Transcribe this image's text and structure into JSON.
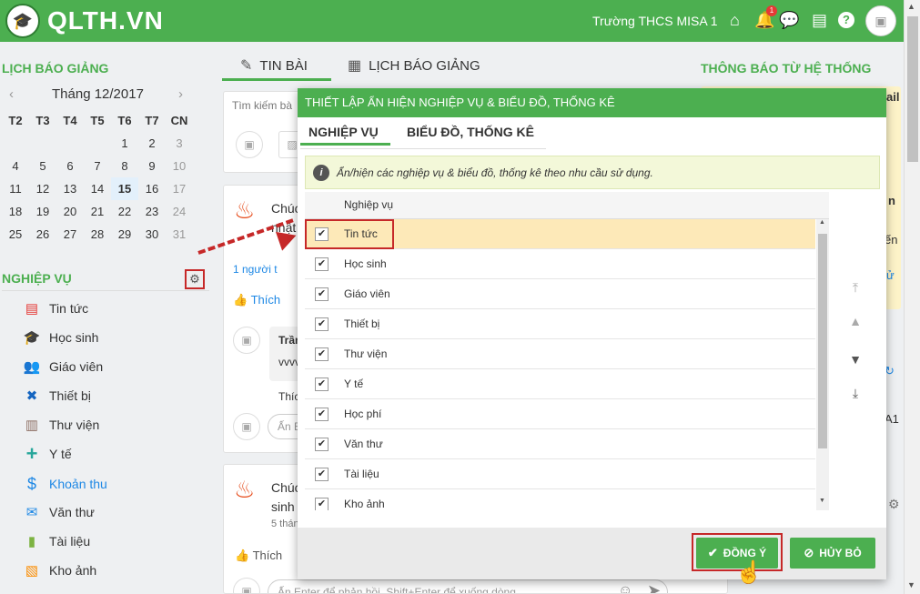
{
  "header": {
    "logo_text": "QLTH.VN",
    "school": "Trường THCS MISA 1",
    "notification_count": "1"
  },
  "calendar": {
    "title": "LỊCH BÁO GIẢNG",
    "month_label": "Tháng 12/2017",
    "prev": "‹",
    "next": "›",
    "weekdays": [
      "T2",
      "T3",
      "T4",
      "T5",
      "T6",
      "T7",
      "CN"
    ],
    "weeks": [
      [
        "",
        "",
        "",
        "",
        "1",
        "2",
        "3"
      ],
      [
        "4",
        "5",
        "6",
        "7",
        "8",
        "9",
        "10"
      ],
      [
        "11",
        "12",
        "13",
        "14",
        "15",
        "16",
        "17"
      ],
      [
        "18",
        "19",
        "20",
        "21",
        "22",
        "23",
        "24"
      ],
      [
        "25",
        "26",
        "27",
        "28",
        "29",
        "30",
        "31"
      ]
    ]
  },
  "sidebar": {
    "title": "NGHIỆP VỤ",
    "items": [
      {
        "label": "Tin tức",
        "icon": "newspaper-icon",
        "color": "#e53935"
      },
      {
        "label": "Học sinh",
        "icon": "graduation-cap-icon",
        "color": "#7b1fa2"
      },
      {
        "label": "Giáo viên",
        "icon": "users-icon",
        "color": "#1e88e5"
      },
      {
        "label": "Thiết bị",
        "icon": "tools-icon",
        "color": "#1565c0"
      },
      {
        "label": "Thư viện",
        "icon": "books-icon",
        "color": "#8d6e63"
      },
      {
        "label": "Y tế",
        "icon": "plus-icon",
        "color": "#26a69a"
      },
      {
        "label": "Khoản thu",
        "icon": "dollar-icon",
        "color": "#1e88e5"
      },
      {
        "label": "Văn thư",
        "icon": "envelope-icon",
        "color": "#1e88e5"
      },
      {
        "label": "Tài liệu",
        "icon": "document-icon",
        "color": "#7cb342"
      },
      {
        "label": "Kho ảnh",
        "icon": "image-icon",
        "color": "#fb8c00"
      }
    ]
  },
  "main_tabs": {
    "news": "TIN BÀI",
    "schedule": "LỊCH BÁO GIẢNG"
  },
  "feed": {
    "search_placeholder": "Tìm kiếm bà",
    "post1_text1": "Chúc",
    "post1_text2": "nhật",
    "post1_likes": "1 người t",
    "like_label": "Thích",
    "comment_name": "Trần",
    "comment_text": "vvvv",
    "comment_like": "Thíc",
    "reply_placeholder1": "Ấn E",
    "post2_text1": "Chúc",
    "post2_text2": "sinh",
    "post2_time": "5 thán",
    "like_label2": "Thích",
    "reply_placeholder2": "Ấn Enter để phản hồi, Shift+Enter để xuống dòng"
  },
  "right_panel": {
    "title": "THÔNG BÁO TỪ HỆ THỐNG",
    "frag1": "ail",
    "frag2": "n",
    "frag3": "ến",
    "frag4": "ử",
    "frag5": "A1"
  },
  "modal": {
    "title": "THIẾT LẬP ẨN HIỆN NGHIỆP VỤ & BIỂU ĐỒ, THỐNG KÊ",
    "tab1": "NGHIỆP VỤ",
    "tab2": "BIỂU ĐỒ, THỐNG KÊ",
    "info": "Ẩn/hiện các nghiệp vụ & biểu đồ, thống kê theo nhu cầu sử dụng.",
    "column_header": "Nghiệp vụ",
    "rows": [
      {
        "label": "Tin tức",
        "checked": true
      },
      {
        "label": "Học sinh",
        "checked": true
      },
      {
        "label": "Giáo viên",
        "checked": true
      },
      {
        "label": "Thiết bị",
        "checked": true
      },
      {
        "label": "Thư viện",
        "checked": true
      },
      {
        "label": "Y tế",
        "checked": true
      },
      {
        "label": "Học phí",
        "checked": true
      },
      {
        "label": "Văn thư",
        "checked": true
      },
      {
        "label": "Tài liệu",
        "checked": true
      },
      {
        "label": "Kho ảnh",
        "checked": true
      }
    ],
    "ok_label": "ĐỒNG Ý",
    "cancel_label": "HỦY BỎ"
  }
}
